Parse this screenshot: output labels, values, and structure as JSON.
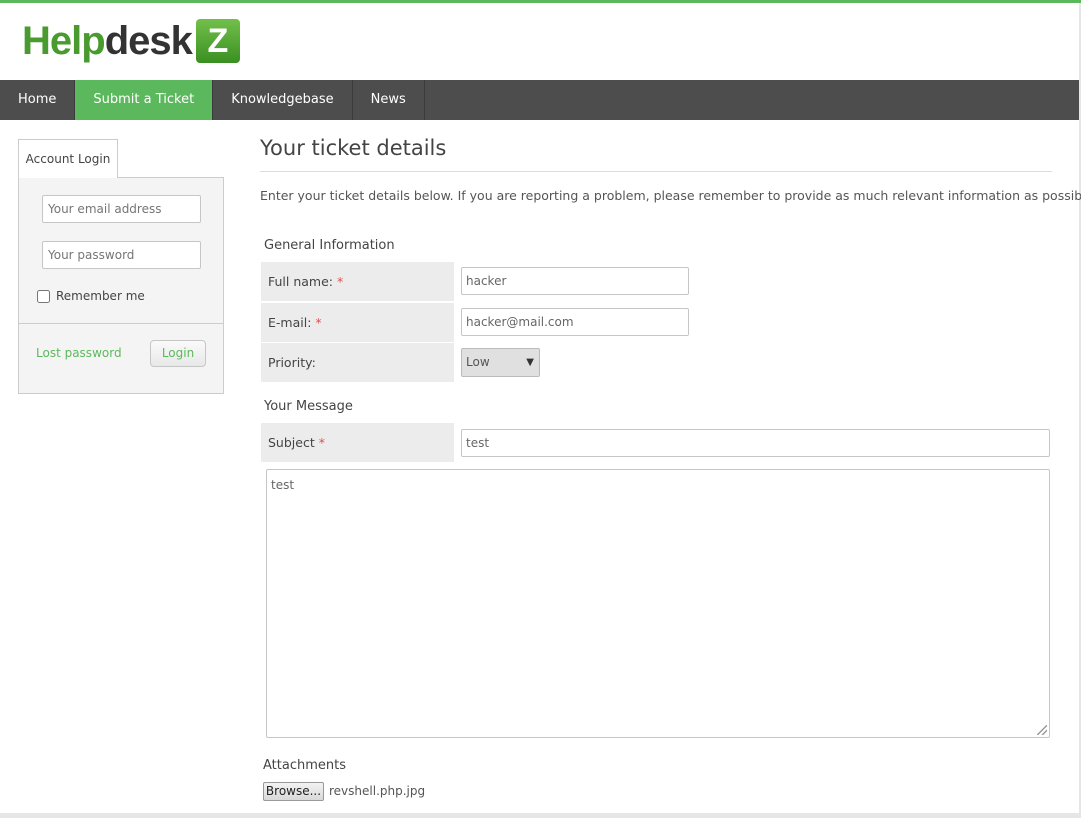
{
  "logo": {
    "part1": "Help",
    "part2": "desk",
    "badge": "Z",
    "brand_color": "#5cb85c"
  },
  "nav": {
    "items": [
      {
        "label": "Home",
        "active": false
      },
      {
        "label": "Submit a Ticket",
        "active": true
      },
      {
        "label": "Knowledgebase",
        "active": false
      },
      {
        "label": "News",
        "active": false
      }
    ]
  },
  "sidebar": {
    "tab_label": "Account Login",
    "email_placeholder": "Your email address",
    "password_placeholder": "Your password",
    "remember_label": "Remember me",
    "remember_checked": false,
    "lost_password_label": "Lost password",
    "login_button_label": "Login"
  },
  "main": {
    "title": "Your ticket details",
    "intro": "Enter your ticket details below. If you are reporting a problem, please remember to provide as much relevant information as possible.",
    "general_section": "General Information",
    "fullname_label": "Full name:",
    "fullname_value": "hacker",
    "email_label": "E-mail:",
    "email_value": "hacker@mail.com",
    "priority_label": "Priority:",
    "priority_value": "Low",
    "message_section": "Your Message",
    "subject_label": "Subject",
    "subject_value": "test",
    "message_value": "test",
    "required_mark": "*",
    "attachments_label": "Attachments",
    "browse_label": "Browse...",
    "file_name": "revshell.php.jpg"
  },
  "icons": {
    "select_arrow": "chevron-down-icon",
    "textarea_grip": "resize-grip-icon"
  }
}
